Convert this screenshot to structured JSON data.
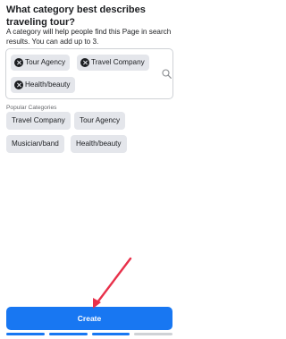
{
  "header": {
    "title": "What category best describes traveling tour?",
    "subtitle": "A category will help people find this Page in search results. You can add up to 3."
  },
  "selected": {
    "chips": [
      {
        "label": "Tour Agency",
        "icon": "remove-icon"
      },
      {
        "label": "Travel Company",
        "icon": "remove-icon"
      },
      {
        "label": "Health/beauty",
        "icon": "remove-icon"
      }
    ],
    "search_icon": "search-icon"
  },
  "popular": {
    "label": "Popular Categories",
    "chips": [
      "Travel Company",
      "Tour Agency",
      "Musician/band",
      "Health/beauty"
    ]
  },
  "footer": {
    "create_label": "Create",
    "progress_steps_total": 4,
    "progress_steps_complete": 3
  },
  "colors": {
    "accent": "#1877f2",
    "chip_bg": "#e4e6eb",
    "annotation_arrow": "#e8304a"
  }
}
